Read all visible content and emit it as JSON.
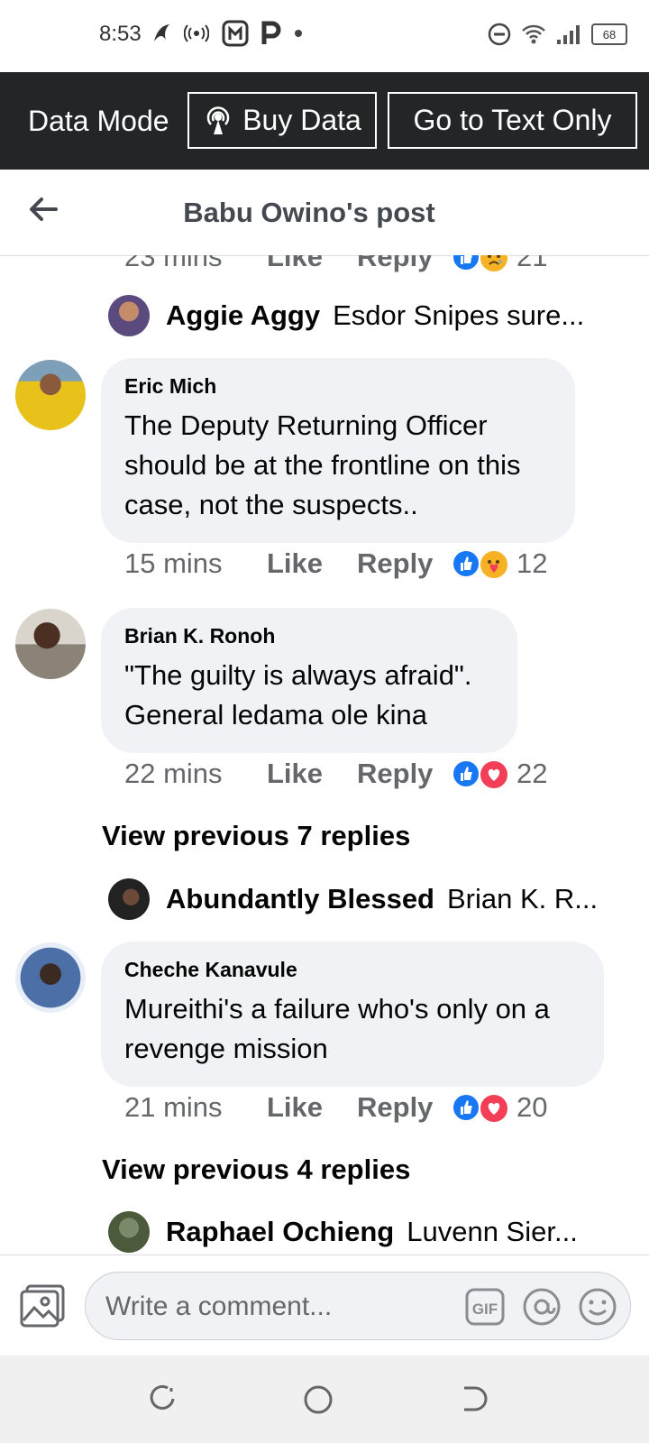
{
  "status_bar": {
    "time": "8:53",
    "battery": "68"
  },
  "data_bar": {
    "mode_label": "Data Mode",
    "buy_label": "Buy Data",
    "text_only_label": "Go to Text Only"
  },
  "header": {
    "title": "Babu Owino's post"
  },
  "comments": [
    {
      "time": "23 mins",
      "like": "Like",
      "reply": "Reply",
      "count": "21"
    },
    {
      "preview_name": "Aggie Aggy",
      "preview_text": "Esdor Snipes sure..."
    },
    {
      "author": "Eric Mich",
      "text": "The Deputy Returning Officer should be at the frontline on this case, not the suspects..",
      "time": "15 mins",
      "like": "Like",
      "reply": "Reply",
      "count": "12"
    },
    {
      "author": "Brian K. Ronoh",
      "text": "\"The guilty is always afraid\". General ledama ole kina",
      "time": "22 mins",
      "like": "Like",
      "reply": "Reply",
      "count": "22"
    },
    {
      "view_previous": "View previous 7 replies",
      "preview_name": "Abundantly Blessed",
      "preview_text": "Brian K. R..."
    },
    {
      "author": "Cheche Kanavule",
      "text": "Mureithi's a failure who's only on a revenge mission",
      "time": "21 mins",
      "like": "Like",
      "reply": "Reply",
      "count": "20"
    },
    {
      "view_previous": "View previous 4 replies",
      "preview_name": "Raphael Ochieng",
      "preview_text": "Luvenn Sier..."
    }
  ],
  "composer": {
    "placeholder": "Write a comment...",
    "gif_label": "GIF"
  },
  "colors": {
    "dark_bar": "#242526",
    "like_blue": "#1877f2",
    "love_red": "#f33e58",
    "bubble_bg": "#f0f2f5"
  }
}
